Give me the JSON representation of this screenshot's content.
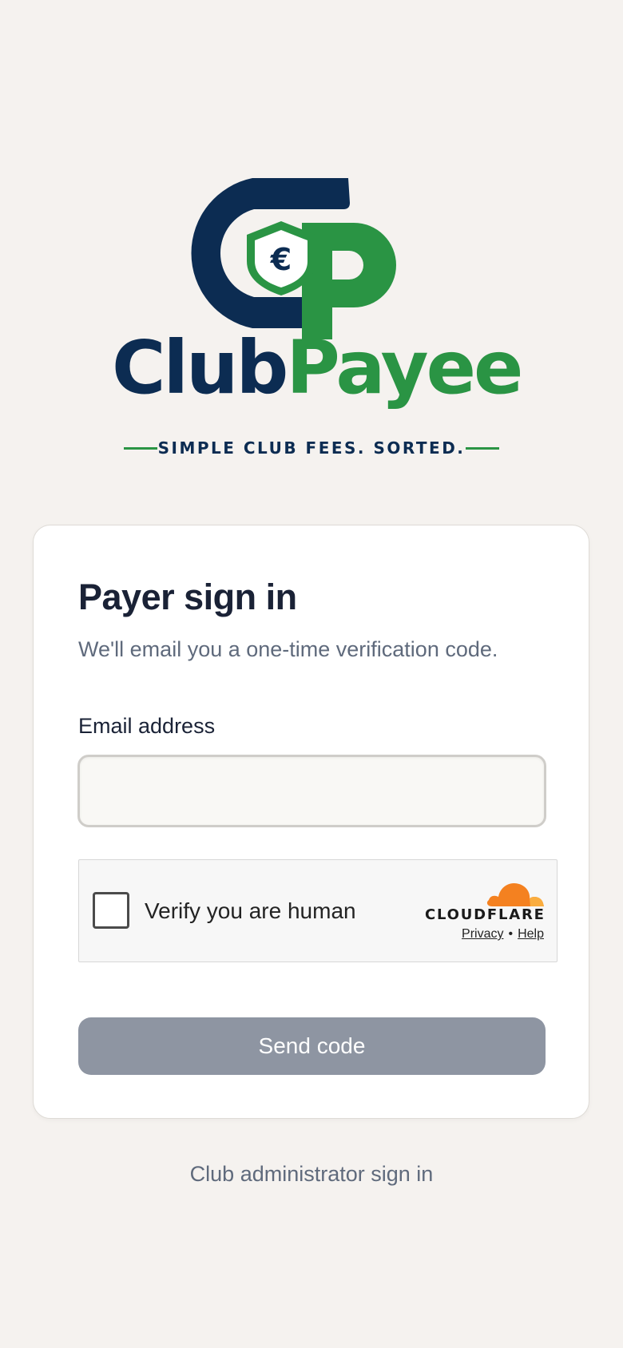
{
  "brand": {
    "name_part1": "Club",
    "name_part2": "Payee",
    "tagline": "SIMPLE CLUB FEES. SORTED.",
    "monogram_symbol": "€",
    "colors": {
      "navy": "#0c2c52",
      "green": "#2a9444"
    }
  },
  "signin": {
    "title": "Payer sign in",
    "subtitle": "We'll email you a one-time verification code.",
    "email_label": "Email address",
    "email_value": "",
    "email_placeholder": ""
  },
  "captcha": {
    "label": "Verify you are human",
    "provider": "CLOUDFLARE",
    "privacy_link": "Privacy",
    "separator": "•",
    "help_link": "Help",
    "checked": false
  },
  "actions": {
    "send_code_label": "Send code",
    "send_code_color": "#8e95a2",
    "admin_link_label": "Club administrator sign in"
  }
}
